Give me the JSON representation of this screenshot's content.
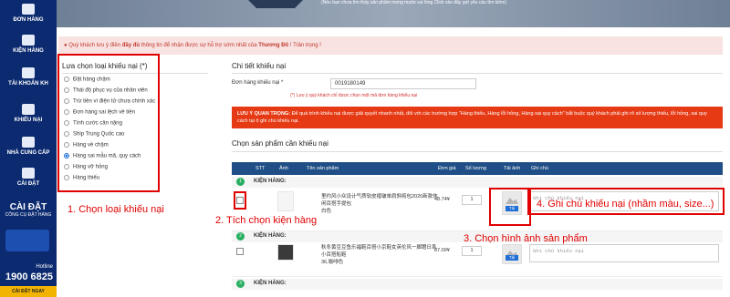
{
  "sidebar": {
    "items": [
      {
        "label": "ĐƠN HÀNG",
        "icon": "orders-icon"
      },
      {
        "label": "KIỆN HÀNG",
        "icon": "package-icon"
      },
      {
        "label": "TÀI KHOẢN KH",
        "icon": "account-icon"
      },
      {
        "label": "KHIẾU NẠI",
        "icon": "complaint-icon"
      },
      {
        "label": "NHÀ CUNG CẤP",
        "icon": "supplier-icon"
      },
      {
        "label": "CÀI ĐẶT",
        "icon": "settings-icon"
      }
    ],
    "install_title": "CÀI ĐẶT",
    "install_sub": "CÔNG CỤ ĐẶT HÀNG",
    "hotline_label": "Hotline",
    "hotline_number": "1900 6825",
    "install_button": "CÀI ĐẶT NGAY"
  },
  "banner": {
    "note": "(Nếu bạn chưa tìm thấy sản phẩm mong muốn vui lòng Click vào đây gửi yêu cầu tìm kiếm)"
  },
  "alert": {
    "text_before": "Quý khách lưu ý điền ",
    "text_bold": "đầy đủ",
    "text_mid": " thông tin để nhận được sự hỗ trợ sớm nhất của ",
    "brand": "Thương Đô",
    "text_after": " ! Trân trọng !"
  },
  "complaint_types": {
    "title": "Lựa chọn loại khiếu nại (*)",
    "options": [
      "Đặt hàng chậm",
      "Thái độ phục vụ của nhân viên",
      "Trừ tiền ví điện tử chưa chính xác",
      "Đơn hàng sai lệch về tiền",
      "Tính cước cân nặng",
      "Ship Trung Quốc cao",
      "Hàng về chậm",
      "Hàng sai mẫu mã, quy cách",
      "Hàng vỡ hỏng",
      "Hàng thiếu"
    ],
    "selected_index": 7
  },
  "detail": {
    "title": "Chi tiết khiếu nại",
    "order_label": "Đơn hàng khiếu nại *",
    "order_value": "0019180149",
    "order_hint": "(*) Lưu ý quý khách chỉ được chọn một mã đơn hàng khiếu nại",
    "warning_prefix": "LƯU Ý QUAN TRỌNG: ",
    "warning_text": "Để quá trình khiếu nại được giải quyết nhanh nhất, đối với các trường hợp \"Hàng thiếu, Hàng lỗi hỏng, Hàng sai quy cách\" bắt buộc quý khách phải ghi rõ số lượng thiếu, lỗi hỏng, sai quy cách tại ô ghi chú khiếu nại."
  },
  "products": {
    "title": "Chọn sản phẩm cần khiếu nại",
    "columns": [
      "STT",
      "Ảnh",
      "Tên sản phẩm",
      "Đơn giá",
      "Số lượng",
      "Tải ảnh",
      "Ghi chú"
    ],
    "group_label": "KIỆN HÀNG:",
    "groups": [
      {
        "num": "1"
      },
      {
        "num": "2"
      },
      {
        "num": "3"
      }
    ],
    "rows": [
      {
        "name": "里约风小众设计气质软皮褶皱单肩斜挎包2020新款休闲百搭手提包",
        "variant": "白色",
        "price": "48.74¥",
        "qty": "1",
        "upload": "Tải",
        "note_placeholder": "Ghi chú khiếu nại"
      },
      {
        "name": "秋冬黄豆豆鱼乐福鞋百搭小京鞋女英伦风一脚蹬日系小百搭船鞋",
        "variant": "36,咖啡色",
        "price": "87.09¥",
        "qty": "1",
        "upload": "Tải",
        "note_placeholder": "Ghi chú khiếu nại"
      }
    ]
  },
  "annotations": {
    "step1": "1. Chọn loại khiếu nại",
    "step2": "2. Tích chọn kiện hàng",
    "step3": "3. Chọn hình ảnh sản phẩm",
    "step4": "4. Ghi chú khiếu nại (nhầm màu, size...)",
    "color": "#e00000"
  }
}
